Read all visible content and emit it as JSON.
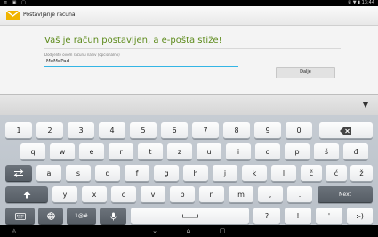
{
  "status_bar": {
    "left_icons": "≡ ▣ ▢",
    "right_text": "✆ ▼ ▮ 13:44"
  },
  "action_bar": {
    "title": "Postavljanje računa"
  },
  "content": {
    "heading": "Vaš je račun postavljen, a e-pošta stiže!",
    "field_label": "Dodijelite ovom računu naziv (opcionalno)",
    "name_value": "MeMoPad",
    "next_label": "Dalje"
  },
  "keyboard": {
    "row1": [
      "1",
      "2",
      "3",
      "4",
      "5",
      "6",
      "7",
      "8",
      "9",
      "0"
    ],
    "row2": [
      "q",
      "w",
      "e",
      "r",
      "t",
      "z",
      "u",
      "i",
      "o",
      "p",
      "š",
      "đ"
    ],
    "row3": [
      "a",
      "s",
      "d",
      "f",
      "g",
      "h",
      "j",
      "k",
      "l",
      "č",
      "ć",
      "ž"
    ],
    "row4": [
      "y",
      "x",
      "c",
      "v",
      "b",
      "n",
      "m",
      ",",
      "."
    ],
    "row4_action": "Next",
    "row5_symbols": "1@#",
    "row5_question": "?",
    "row5_exclaim": "!",
    "row5_apostrophe": "'",
    "row5_smiley": ":-)"
  }
}
